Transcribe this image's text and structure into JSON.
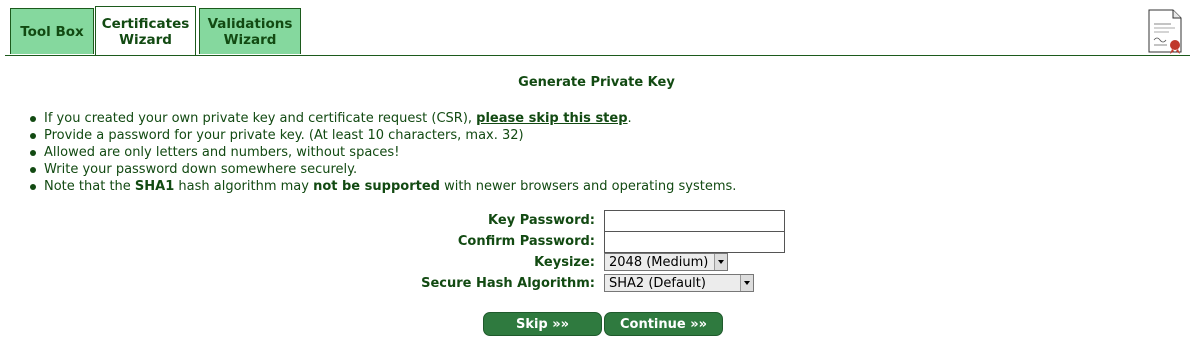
{
  "tabs": [
    {
      "label": "Tool Box"
    },
    {
      "label": "Certificates Wizard"
    },
    {
      "label": "Validations Wizard"
    }
  ],
  "header_icon": "certificate-document-icon",
  "page": {
    "title": "Generate Private Key",
    "notes": {
      "n1_pre": "If you created your own private key and certificate request (CSR), ",
      "n1_link": "please skip this step",
      "n1_post": ".",
      "n2": "Provide a password for your private key. (At least 10 characters, max. 32)",
      "n3": "Allowed are only letters and numbers, without spaces!",
      "n4": "Write your password down somewhere securely.",
      "n5_a": "Note that the ",
      "n5_b": "SHA1",
      "n5_c": " hash algorithm may ",
      "n5_d": "not be supported",
      "n5_e": " with newer browsers and operating systems."
    }
  },
  "form": {
    "key_password_label": "Key Password:",
    "key_password_value": "",
    "confirm_password_label": "Confirm Password:",
    "confirm_password_value": "",
    "keysize_label": "Keysize:",
    "keysize_value": "2048 (Medium)",
    "hash_label": "Secure Hash Algorithm:",
    "hash_value": "SHA2 (Default)"
  },
  "buttons": {
    "skip": "Skip »»",
    "continue": "Continue »»"
  },
  "colors": {
    "tab_bg": "#85d89e",
    "text": "#124a12",
    "button_bg": "#2f7a3f"
  }
}
